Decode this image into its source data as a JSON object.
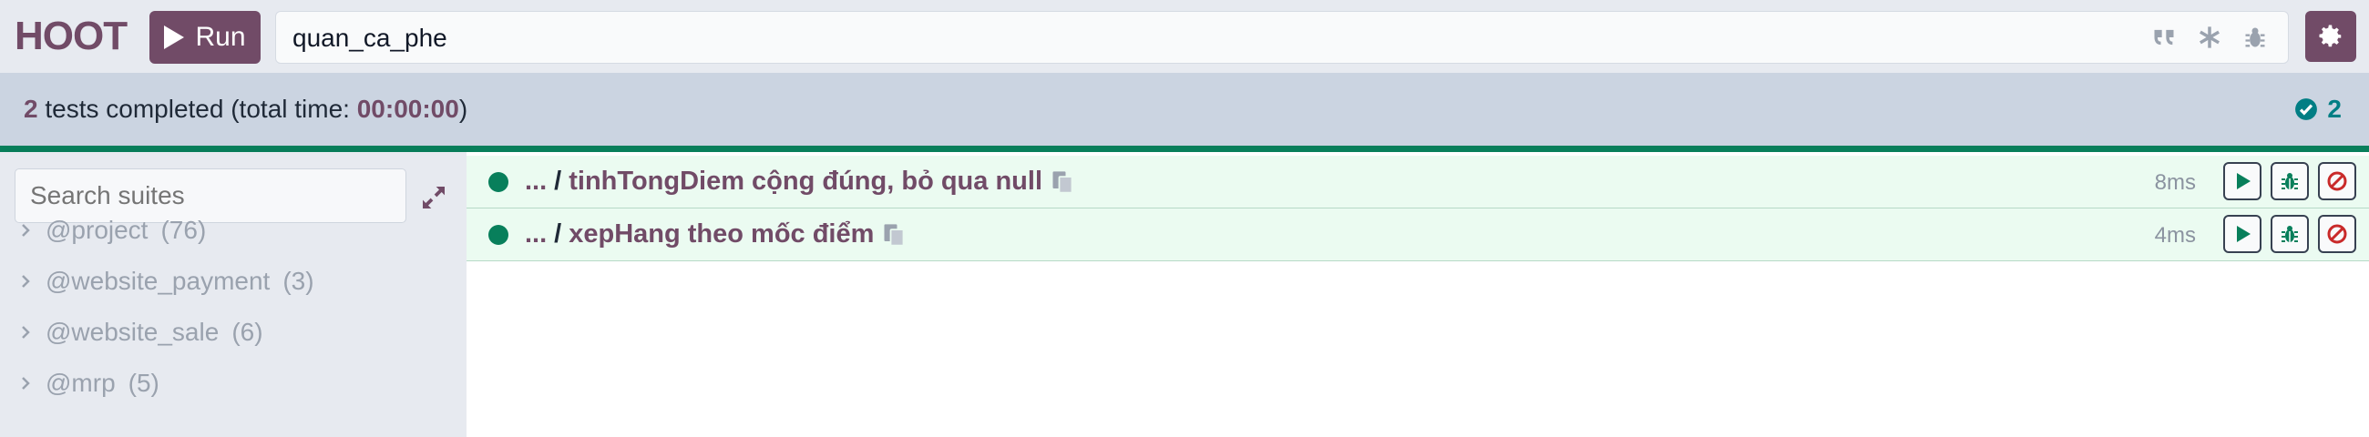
{
  "app": {
    "logo": "HOOT"
  },
  "toolbar": {
    "run_label": "Run",
    "filter_value": "quan_ca_phe"
  },
  "status": {
    "count": "2",
    "text_middle": " tests completed (total time: ",
    "time": "00:00:00",
    "text_end": ")",
    "passed_count": "2"
  },
  "sidebar": {
    "search_placeholder": "Search suites",
    "suites": [
      {
        "name": "@project",
        "count": "(76)"
      },
      {
        "name": "@website_payment",
        "count": "(3)"
      },
      {
        "name": "@website_sale",
        "count": "(6)"
      },
      {
        "name": "@mrp",
        "count": "(5)"
      }
    ]
  },
  "tests": [
    {
      "prefix": "...",
      "sep": "/",
      "name": "tinhTongDiem cộng đúng, bỏ qua null",
      "duration": "8ms"
    },
    {
      "prefix": "...",
      "sep": "/",
      "name": "xepHang theo mốc điểm",
      "duration": "4ms"
    }
  ],
  "colors": {
    "brand": "#714b67",
    "success": "#087f5b",
    "danger": "#c92a2a"
  }
}
